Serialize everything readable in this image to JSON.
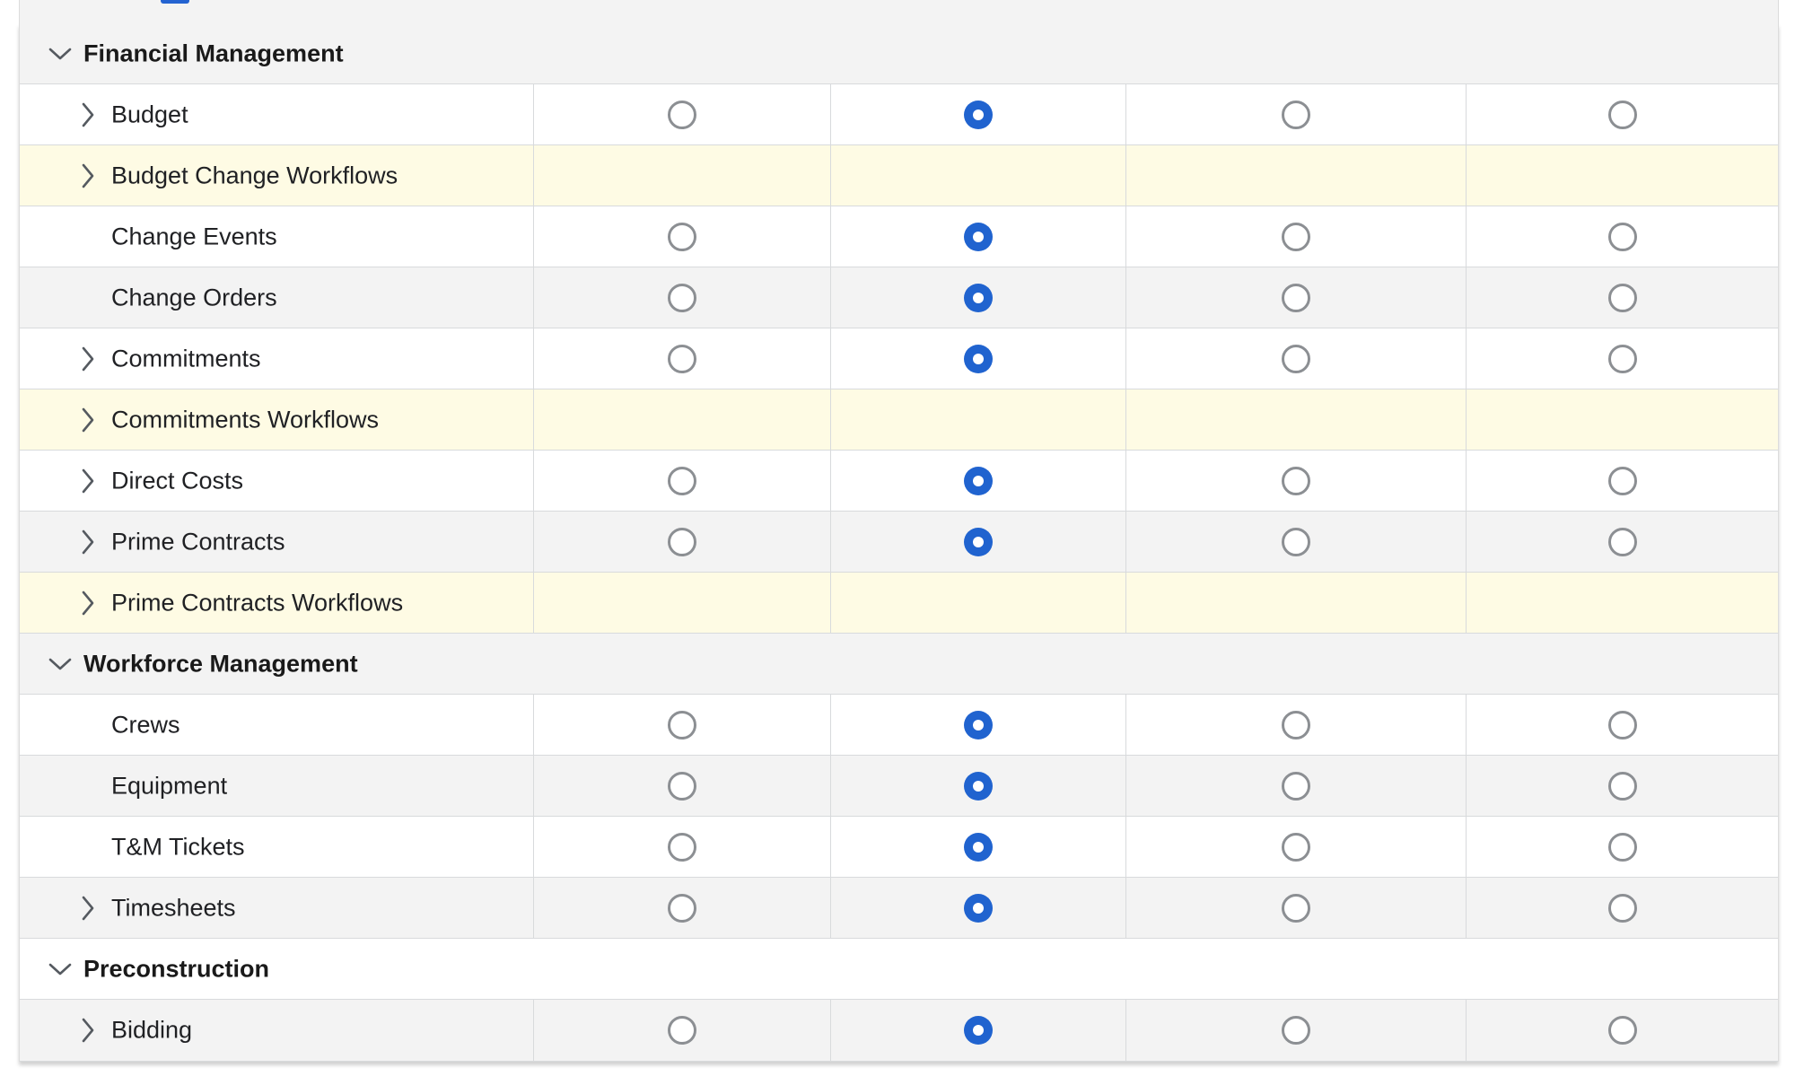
{
  "top_strip": {
    "cut_text": ""
  },
  "sections": [
    {
      "title": "Financial Management",
      "tools": [
        {
          "label": "Budget",
          "expandable": true,
          "selected": 1,
          "workflow": false
        },
        {
          "label": "Budget Change Workflows",
          "expandable": true,
          "selected": null,
          "workflow": true
        },
        {
          "label": "Change Events",
          "expandable": false,
          "selected": 1,
          "workflow": false
        },
        {
          "label": "Change Orders",
          "expandable": false,
          "selected": 1,
          "workflow": false
        },
        {
          "label": "Commitments",
          "expandable": true,
          "selected": 1,
          "workflow": false
        },
        {
          "label": "Commitments Workflows",
          "expandable": true,
          "selected": null,
          "workflow": true
        },
        {
          "label": "Direct Costs",
          "expandable": true,
          "selected": 1,
          "workflow": false
        },
        {
          "label": "Prime Contracts",
          "expandable": true,
          "selected": 1,
          "workflow": false
        },
        {
          "label": "Prime Contracts Workflows",
          "expandable": true,
          "selected": null,
          "workflow": true
        }
      ]
    },
    {
      "title": "Workforce Management",
      "tools": [
        {
          "label": "Crews",
          "expandable": false,
          "selected": 1,
          "workflow": false
        },
        {
          "label": "Equipment",
          "expandable": false,
          "selected": 1,
          "workflow": false
        },
        {
          "label": "T&M Tickets",
          "expandable": false,
          "selected": 1,
          "workflow": false
        },
        {
          "label": "Timesheets",
          "expandable": true,
          "selected": 1,
          "workflow": false
        }
      ]
    },
    {
      "title": "Preconstruction",
      "tools": [
        {
          "label": "Bidding",
          "expandable": true,
          "selected": 1,
          "workflow": false
        }
      ]
    }
  ],
  "colors": {
    "accent": "#2063cf",
    "row_alt": "#f3f3f3",
    "workflow_row": "#fefbe4",
    "radio_border": "#8c8f93"
  },
  "icons": {
    "section_toggle": "chevron-down-icon",
    "tool_toggle": "chevron-right-icon"
  }
}
